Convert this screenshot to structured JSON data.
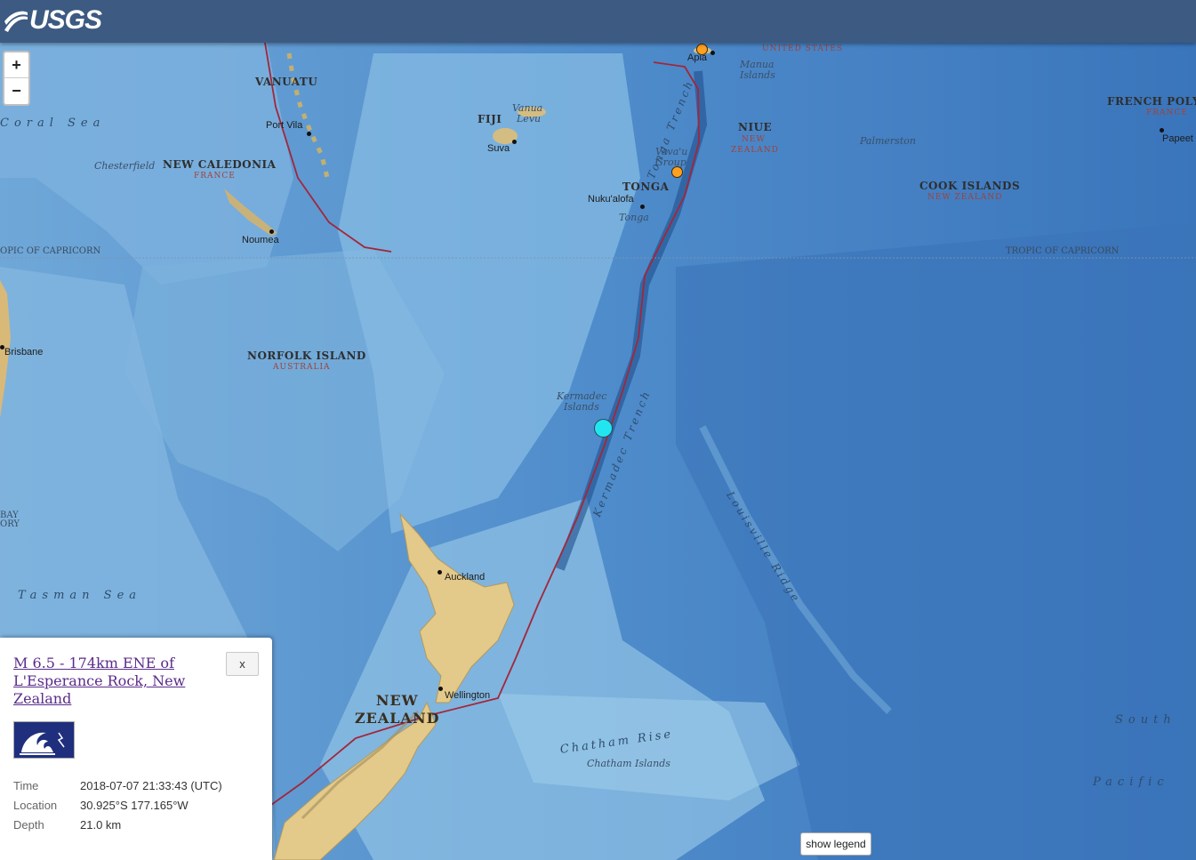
{
  "header": {
    "logo_text": "USGS"
  },
  "zoom": {
    "in_label": "+",
    "out_label": "−"
  },
  "map_labels": {
    "vanuatu": "VANUATU",
    "coral_sea": "Coral Sea",
    "port_vila": "Port Vila",
    "fiji": "FIJI",
    "vanua_levu_1": "Vanua",
    "vanua_levu_2": "Levu",
    "suva": "Suva",
    "apia": "Apia",
    "united_states": "UNITED STATES",
    "manua_1": "Manua",
    "manua_2": "Islands",
    "niue": "NIUE",
    "niue_nz_1": "NEW",
    "niue_nz_2": "ZEALAND",
    "palmerston": "Palmerston",
    "french_polynesia": "FRENCH POLYN",
    "france_east": "FRANCE",
    "papeete": "Papeet",
    "chesterfield": "Chesterfield",
    "new_caledonia": "NEW CALEDONIA",
    "france_west": "FRANCE",
    "noumea": "Noumea",
    "vavau_1": "Vava'u",
    "vavau_2": "Group",
    "tonga": "TONGA",
    "nukualofa": "Nuku'alofa",
    "tonga_island": "Tonga",
    "tonga_trench": "Tonga Trench",
    "cook_islands": "COOK ISLANDS",
    "cook_nz": "NEW ZEALAND",
    "tropic_west": "OPIC OF CAPRICORN",
    "tropic_east": "TROPIC OF CAPRICORN",
    "brisbane": "Brisbane",
    "norfolk_island": "NORFOLK ISLAND",
    "australia": "AUSTRALIA",
    "kermadec_1": "Kermadec",
    "kermadec_2": "Islands",
    "kermadec_trench": "Kermadec Trench",
    "louisville_ridge": "Louisville Ridge",
    "bay_1": "BAY",
    "bay_2": "ORY",
    "tasman_sea": "Tasman Sea",
    "auckland": "Auckland",
    "wellington": "Wellington",
    "new_zealand_1": "NEW",
    "new_zealand_2": "ZEALAND",
    "chatham_rise": "Chatham Rise",
    "chatham_islands": "Chatham Islands",
    "south": "South",
    "pacific": "Pacific"
  },
  "colors": {
    "header_bg": "#3c5a82",
    "ocean_deep": "#2f6db0",
    "ocean_shelf": "#8fc0e3",
    "land": "#e3c98a",
    "plate_boundary": "#a3263a",
    "main_event": "#21e6f0",
    "other_event": "#ffa01e"
  },
  "popup": {
    "title": "M 6.5 - 174km ENE of L'Esperance Rock, New Zealand",
    "close_label": "x",
    "badge_icon": "tsunami-wave-icon",
    "rows": [
      {
        "key": "Time",
        "value": "2018-07-07 21:33:43 (UTC)"
      },
      {
        "key": "Location",
        "value": "30.925°S 177.165°W"
      },
      {
        "key": "Depth",
        "value": "21.0 km"
      }
    ]
  },
  "legend_button": "show legend"
}
